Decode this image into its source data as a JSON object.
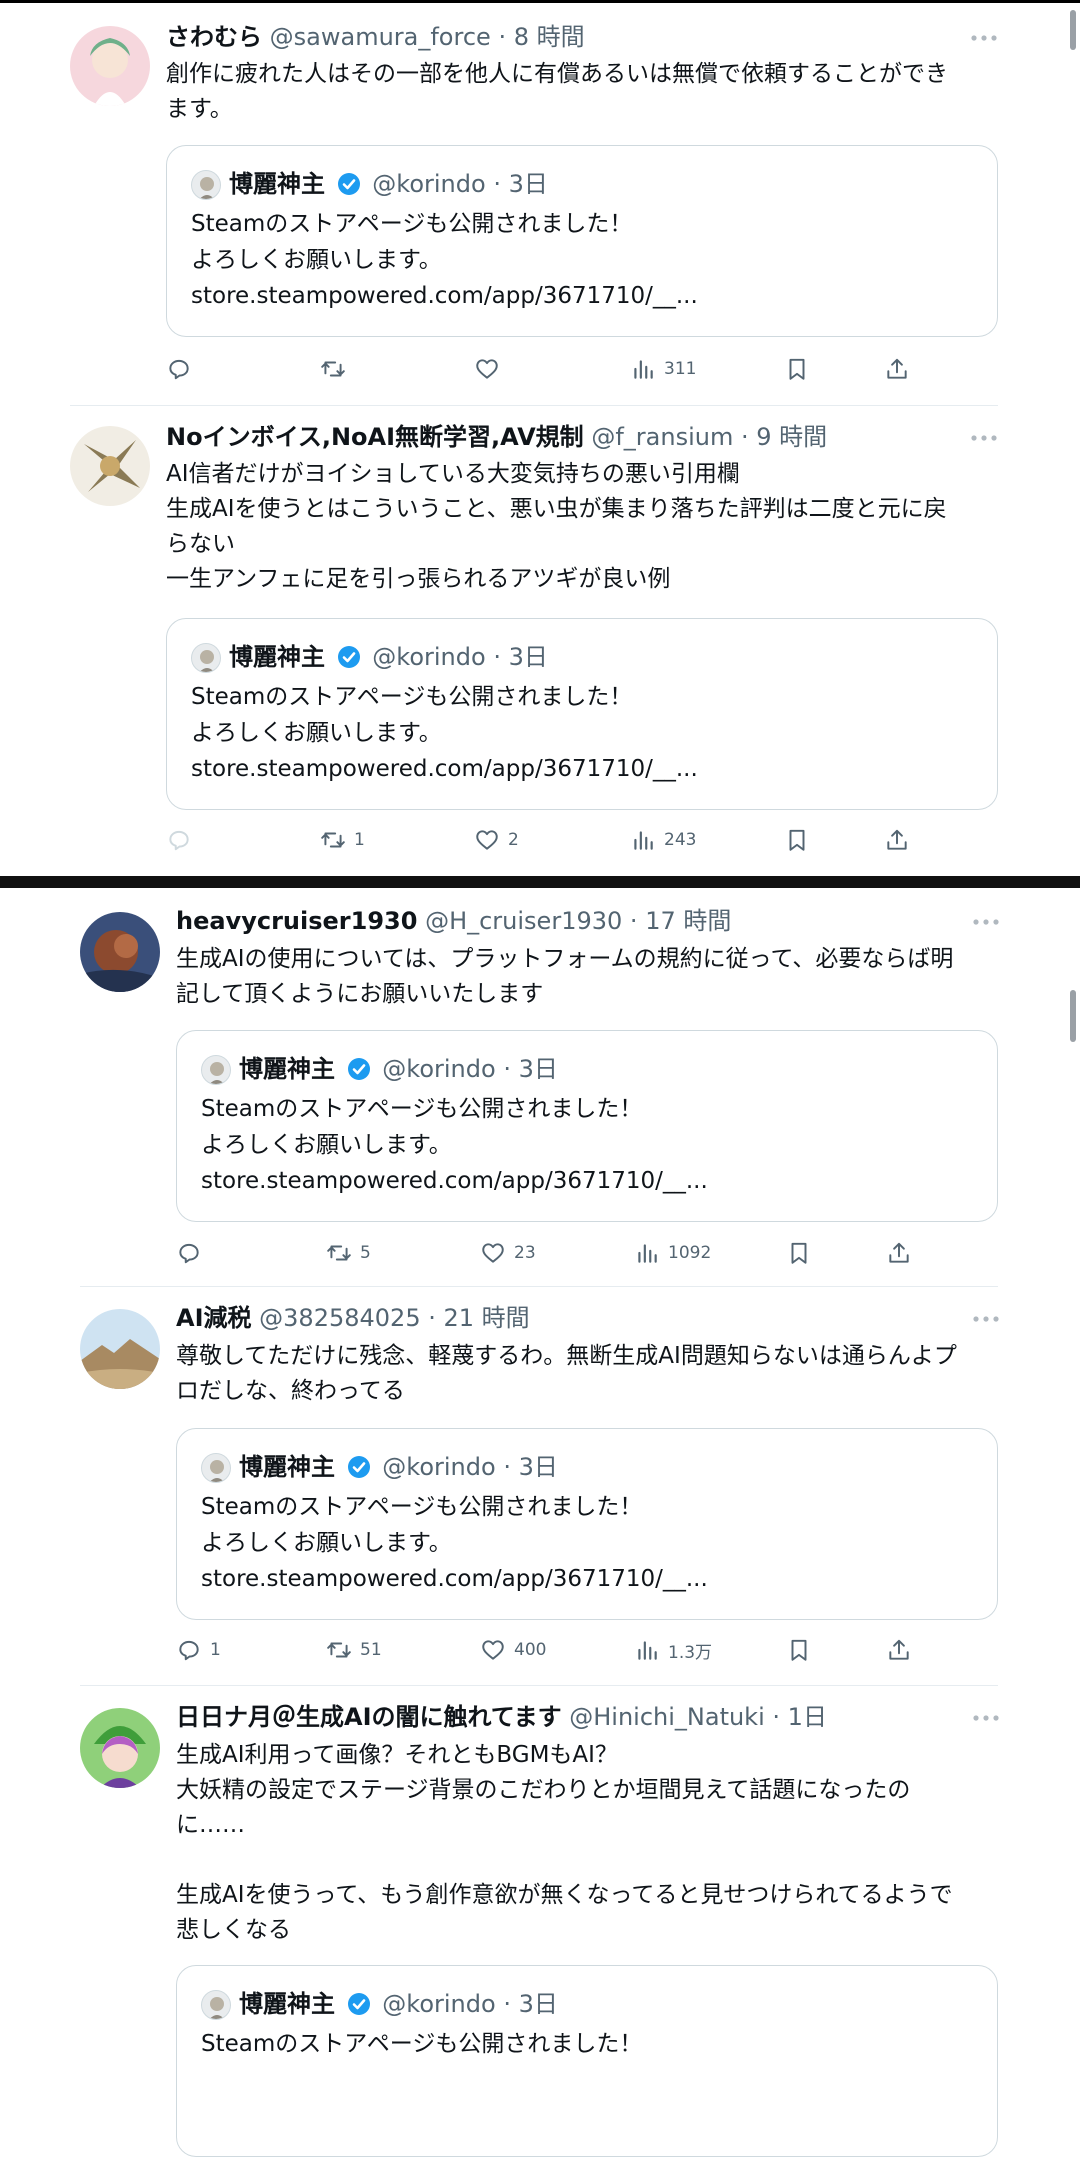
{
  "colors": {
    "accent": "#1d9bf0",
    "text": "#0f1419",
    "muted": "#536471",
    "border": "#cfd9de"
  },
  "quoted_tweet": {
    "name": "博麗神主",
    "handle": "@korindo",
    "time": "3日",
    "lines": [
      "Steamのストアページも公開されました！",
      "よろしくお願いします。",
      "store.steampowered.com/app/3671710/__..."
    ]
  },
  "tweets": [
    {
      "name": "さわむら",
      "handle": "@sawamura_force",
      "time": "8 時間",
      "lines": [
        "創作に疲れた人はその一部を他人に有償あるいは無償で依頼することができ",
        "ます。"
      ],
      "reply_count": "",
      "retweet_count": "",
      "like_count": "",
      "view_count": "311"
    },
    {
      "name": "Noインボイス,NoAI無断学習,AV規制",
      "handle": "@f_ransium",
      "time": "9 時間",
      "lines": [
        "AI信者だけがヨイショしている大変気持ちの悪い引用欄",
        "生成AIを使うとはこういうこと、悪い虫が集まり落ちた評判は二度と元に戻",
        "らない",
        "一生アンフェに足を引っ張られるアツギが良い例"
      ],
      "reply_count": "",
      "retweet_count": "1",
      "like_count": "2",
      "view_count": "243"
    },
    {
      "name": "heavycruiser1930",
      "handle": "@H_cruiser1930",
      "time": "17 時間",
      "lines": [
        "生成AIの使用については、プラットフォームの規約に従って、必要ならば明",
        "記して頂くようにお願いいたします"
      ],
      "reply_count": "",
      "retweet_count": "5",
      "like_count": "23",
      "view_count": "1092"
    },
    {
      "name": "AI減税",
      "handle": "@382584025",
      "time": "21 時間",
      "lines": [
        "尊敬してただけに残念、軽蔑するわ。無断生成AI問題知らないは通らんよプ",
        "ロだしな、終わってる"
      ],
      "reply_count": "1",
      "retweet_count": "51",
      "like_count": "400",
      "view_count": "1.3万"
    },
    {
      "name": "日日ナ月＠生成AIの闇に触れてます",
      "handle": "@Hinichi_Natuki",
      "time": "1日",
      "lines": [
        "生成AI利用って画像？それともBGMもAI？",
        "大妖精の設定でステージ背景のこだわりとか垣間見えて話題になったの",
        "に……",
        "",
        "生成AIを使うって、もう創作意欲が無くなってると見せつけられてるようで",
        "悲しくなる"
      ],
      "reply_count": "",
      "retweet_count": "",
      "like_count": "",
      "view_count": ""
    }
  ]
}
